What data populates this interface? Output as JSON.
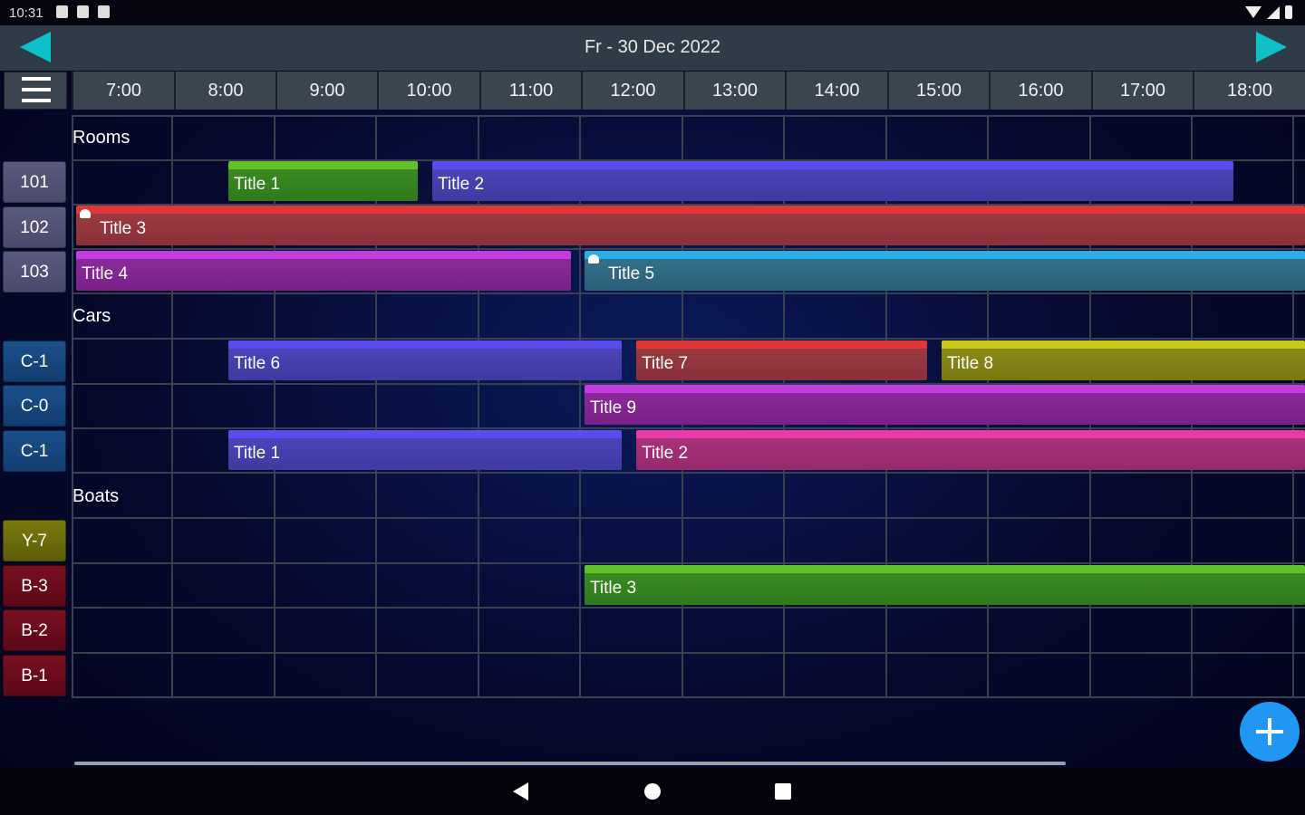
{
  "status_bar": {
    "time": "10:31"
  },
  "header": {
    "date": "Fr - 30 Dec 2022"
  },
  "hours": [
    "7:00",
    "8:00",
    "9:00",
    "10:00",
    "11:00",
    "12:00",
    "13:00",
    "14:00",
    "15:00",
    "16:00",
    "17:00",
    "18:00"
  ],
  "sections": {
    "rooms": "Rooms",
    "cars": "Cars",
    "boats": "Boats"
  },
  "resources": {
    "r101": "101",
    "r102": "102",
    "r103": "103",
    "c1a": "C-1",
    "c0": "C-0",
    "c1b": "C-1",
    "y7": "Y-7",
    "b3": "B-3",
    "b2": "B-2",
    "b1": "B-1"
  },
  "events": {
    "e1": {
      "title": "Title 1",
      "start": "8:30",
      "end": "10:20",
      "resource": "101",
      "color": "#3a8a22"
    },
    "e2": {
      "title": "Title 2",
      "start": "10:25",
      "end": "18:15",
      "resource": "101",
      "color": "#4a44b8"
    },
    "e3": {
      "title": "Title 3",
      "start": "7:00",
      "end": "19:00+",
      "resource": "102",
      "color": "#9a3a40",
      "alarm": true
    },
    "e4": {
      "title": "Title 4",
      "start": "7:00",
      "end": "11:50",
      "resource": "103",
      "color": "#8a2a9a"
    },
    "e5": {
      "title": "Title 5",
      "start": "12:00",
      "end": "19:00+",
      "resource": "103",
      "color": "#33708a",
      "alarm": true
    },
    "e6": {
      "title": "Title 6",
      "start": "8:30",
      "end": "12:25",
      "resource": "C-1",
      "color": "#4a44b8"
    },
    "e7": {
      "title": "Title 7",
      "start": "12:30",
      "end": "15:25",
      "resource": "C-1",
      "color": "#9a3a40"
    },
    "e8": {
      "title": "Title 8",
      "start": "15:30",
      "end": "19:00+",
      "resource": "C-1",
      "color": "#8a8a18"
    },
    "e9": {
      "title": "Title 9",
      "start": "12:00",
      "end": "19:00+",
      "resource": "C-0",
      "color": "#8a2a9a"
    },
    "e10": {
      "title": "Title 1",
      "start": "8:30",
      "end": "12:25",
      "resource": "C-1",
      "color": "#4a44b8"
    },
    "e11": {
      "title": "Title 2",
      "start": "12:30",
      "end": "19:00+",
      "resource": "C-1",
      "color": "#a8307a"
    },
    "e12": {
      "title": "Title 3",
      "start": "12:00",
      "end": "19:00+",
      "resource": "B-3",
      "color": "#3a8a22"
    }
  },
  "colors": {
    "accent": "#10c0c8",
    "fab": "#2196f3",
    "header_bg": "#2f3c48"
  }
}
